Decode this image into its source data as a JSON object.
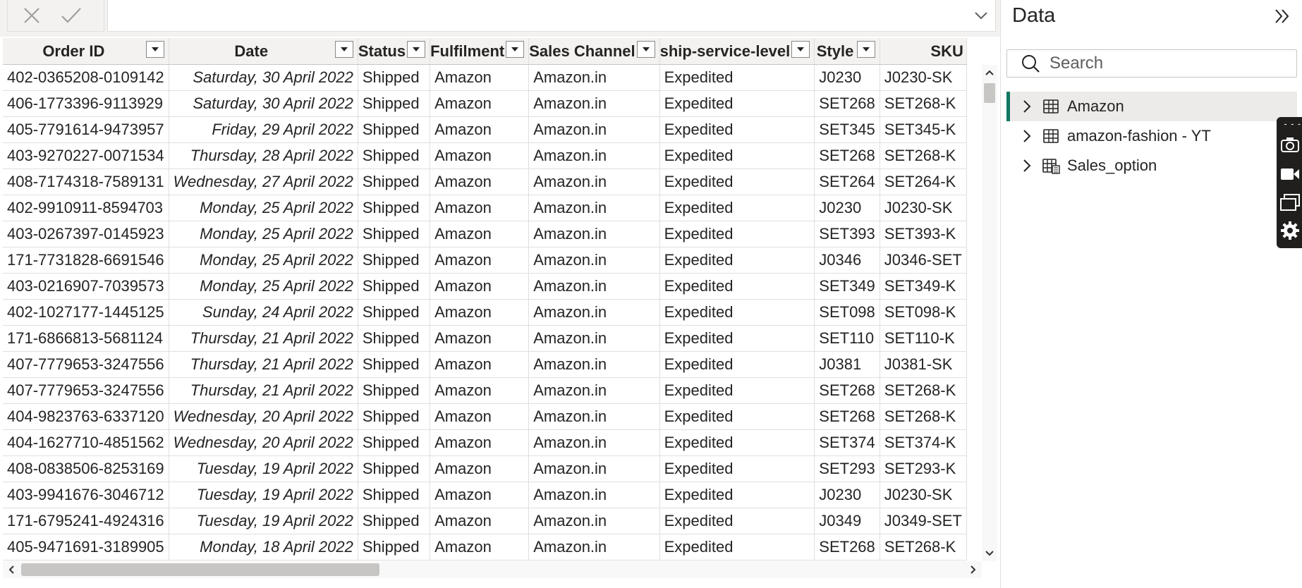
{
  "formula_bar": {
    "cancel_icon": "close-icon",
    "commit_icon": "check-icon",
    "expand_icon": "chevron-down-icon"
  },
  "table": {
    "columns": [
      {
        "key": "order_id",
        "label": "Order ID"
      },
      {
        "key": "date",
        "label": "Date"
      },
      {
        "key": "status",
        "label": "Status"
      },
      {
        "key": "fulfilment",
        "label": "Fulfilment"
      },
      {
        "key": "sales_channel",
        "label": "Sales Channel"
      },
      {
        "key": "ship_service_level",
        "label": "ship-service-level"
      },
      {
        "key": "style",
        "label": "Style"
      },
      {
        "key": "sku",
        "label": "SKU"
      }
    ],
    "rows": [
      [
        "402-0365208-0109142",
        "Saturday, 30 April 2022",
        "Shipped",
        "Amazon",
        "Amazon.in",
        "Expedited",
        "J0230",
        "J0230-SK"
      ],
      [
        "406-1773396-9113929",
        "Saturday, 30 April 2022",
        "Shipped",
        "Amazon",
        "Amazon.in",
        "Expedited",
        "SET268",
        "SET268-K"
      ],
      [
        "405-7791614-9473957",
        "Friday, 29 April 2022",
        "Shipped",
        "Amazon",
        "Amazon.in",
        "Expedited",
        "SET345",
        "SET345-K"
      ],
      [
        "403-9270227-0071534",
        "Thursday, 28 April 2022",
        "Shipped",
        "Amazon",
        "Amazon.in",
        "Expedited",
        "SET268",
        "SET268-K"
      ],
      [
        "408-7174318-7589131",
        "Wednesday, 27 April 2022",
        "Shipped",
        "Amazon",
        "Amazon.in",
        "Expedited",
        "SET264",
        "SET264-K"
      ],
      [
        "402-9910911-8594703",
        "Monday, 25 April 2022",
        "Shipped",
        "Amazon",
        "Amazon.in",
        "Expedited",
        "J0230",
        "J0230-SK"
      ],
      [
        "403-0267397-0145923",
        "Monday, 25 April 2022",
        "Shipped",
        "Amazon",
        "Amazon.in",
        "Expedited",
        "SET393",
        "SET393-K"
      ],
      [
        "171-7731828-6691546",
        "Monday, 25 April 2022",
        "Shipped",
        "Amazon",
        "Amazon.in",
        "Expedited",
        "J0346",
        "J0346-SET"
      ],
      [
        "403-0216907-7039573",
        "Monday, 25 April 2022",
        "Shipped",
        "Amazon",
        "Amazon.in",
        "Expedited",
        "SET349",
        "SET349-K"
      ],
      [
        "402-1027177-1445125",
        "Sunday, 24 April 2022",
        "Shipped",
        "Amazon",
        "Amazon.in",
        "Expedited",
        "SET098",
        "SET098-K"
      ],
      [
        "171-6866813-5681124",
        "Thursday, 21 April 2022",
        "Shipped",
        "Amazon",
        "Amazon.in",
        "Expedited",
        "SET110",
        "SET110-K"
      ],
      [
        "407-7779653-3247556",
        "Thursday, 21 April 2022",
        "Shipped",
        "Amazon",
        "Amazon.in",
        "Expedited",
        "J0381",
        "J0381-SK"
      ],
      [
        "407-7779653-3247556",
        "Thursday, 21 April 2022",
        "Shipped",
        "Amazon",
        "Amazon.in",
        "Expedited",
        "SET268",
        "SET268-K"
      ],
      [
        "404-9823763-6337120",
        "Wednesday, 20 April 2022",
        "Shipped",
        "Amazon",
        "Amazon.in",
        "Expedited",
        "SET268",
        "SET268-K"
      ],
      [
        "404-1627710-4851562",
        "Wednesday, 20 April 2022",
        "Shipped",
        "Amazon",
        "Amazon.in",
        "Expedited",
        "SET374",
        "SET374-K"
      ],
      [
        "408-0838506-8253169",
        "Tuesday, 19 April 2022",
        "Shipped",
        "Amazon",
        "Amazon.in",
        "Expedited",
        "SET293",
        "SET293-K"
      ],
      [
        "403-9941676-3046712",
        "Tuesday, 19 April 2022",
        "Shipped",
        "Amazon",
        "Amazon.in",
        "Expedited",
        "J0230",
        "J0230-SK"
      ],
      [
        "171-6795241-4924316",
        "Tuesday, 19 April 2022",
        "Shipped",
        "Amazon",
        "Amazon.in",
        "Expedited",
        "J0349",
        "J0349-SET"
      ],
      [
        "405-9471691-3189905",
        "Monday, 18 April 2022",
        "Shipped",
        "Amazon",
        "Amazon.in",
        "Expedited",
        "SET268",
        "SET268-K"
      ]
    ]
  },
  "data_pane": {
    "title": "Data",
    "search_placeholder": "Search",
    "tables": [
      {
        "name": "Amazon",
        "icon": "table-icon",
        "selected": true
      },
      {
        "name": "amazon-fashion - YT",
        "icon": "table-icon",
        "selected": false
      },
      {
        "name": "Sales_option",
        "icon": "calculated-table-icon",
        "selected": false
      }
    ]
  },
  "floating_toolbar": {
    "icons": [
      "camera-icon",
      "video-icon",
      "window-icon",
      "gear-icon"
    ]
  },
  "colors": {
    "accent": "#117865",
    "header_bg": "#f3f2f1",
    "border": "#e1dfdd"
  }
}
